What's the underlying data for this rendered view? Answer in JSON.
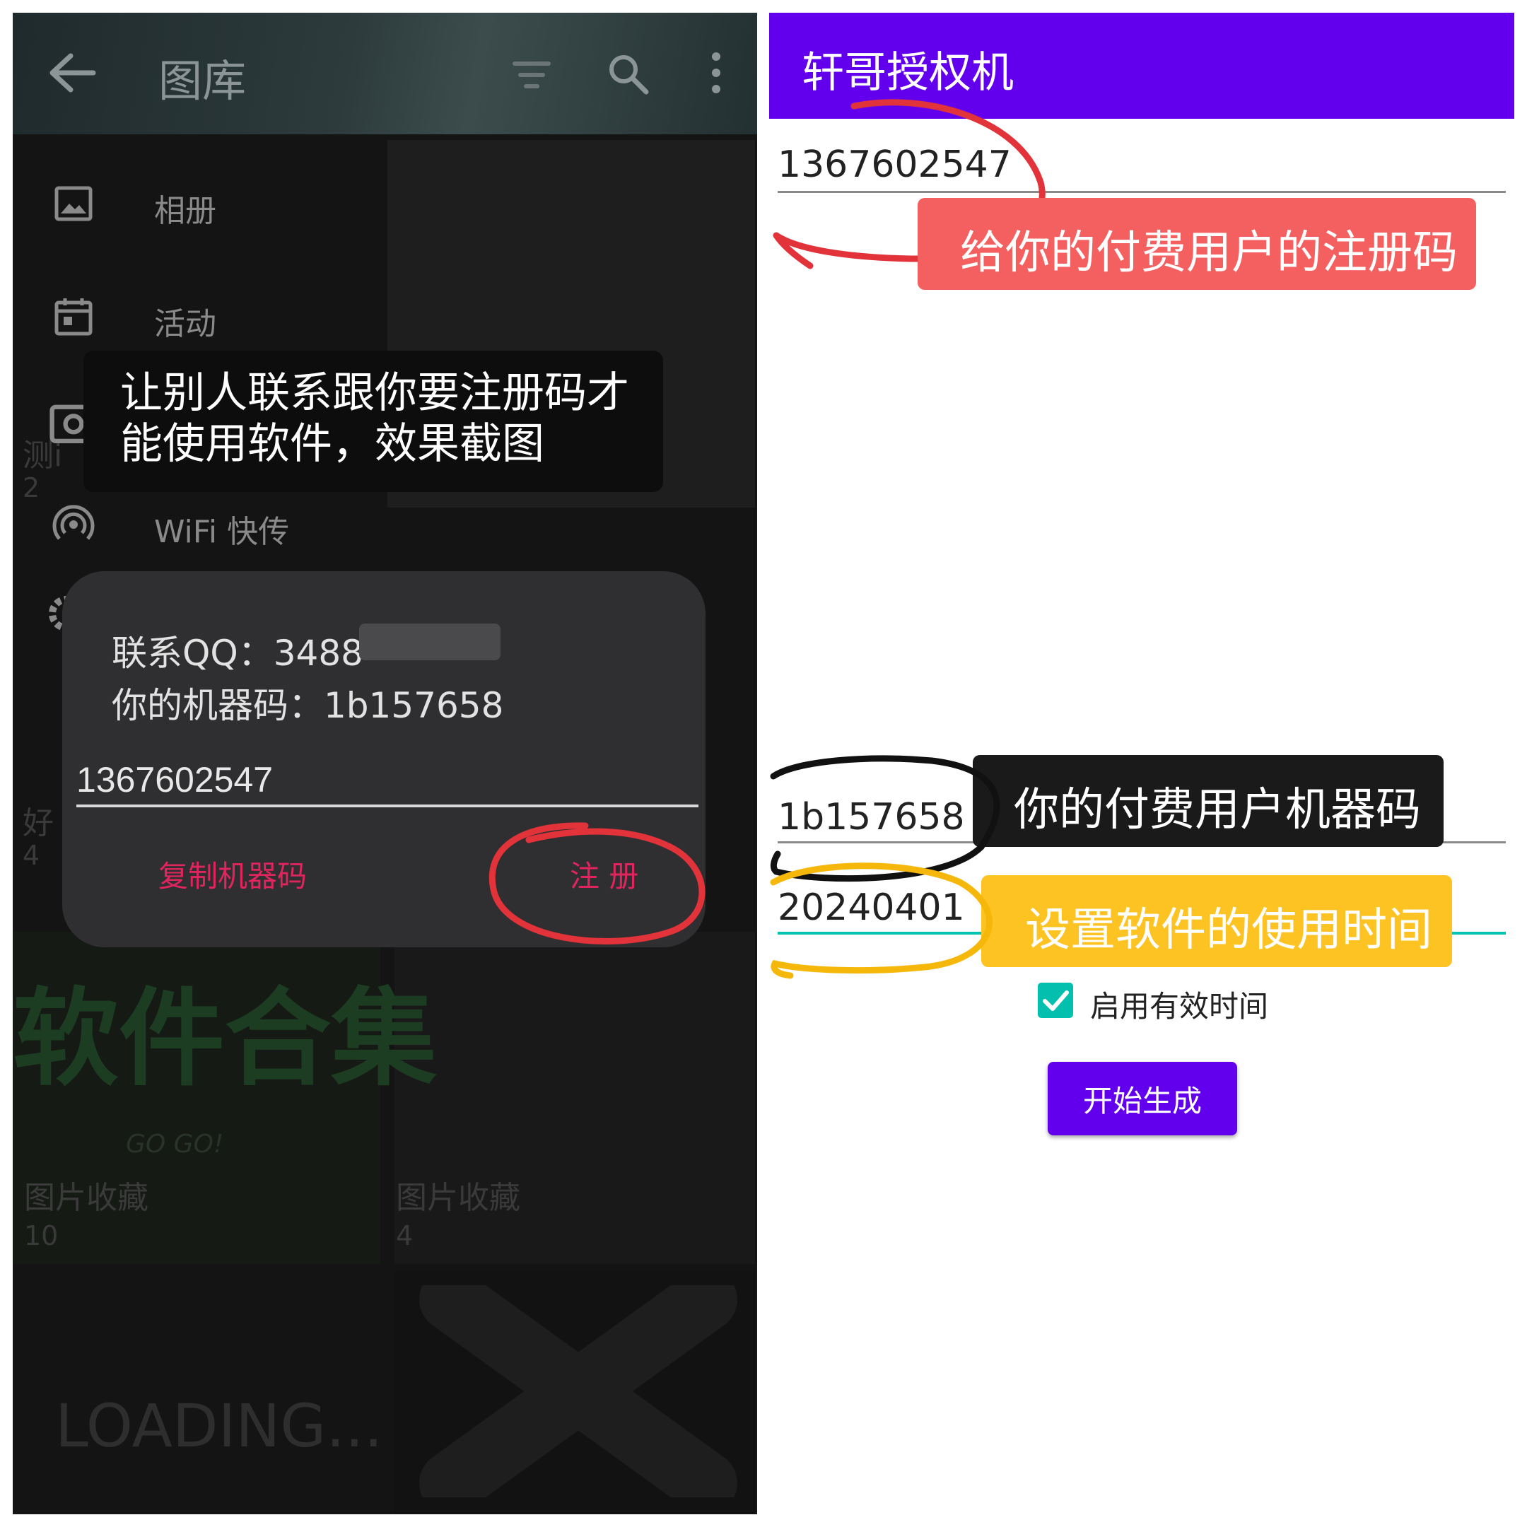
{
  "left": {
    "toolbar": {
      "title": "图库",
      "back_icon": "arrow-left-icon",
      "filter_icon": "filter-icon",
      "search_icon": "search-icon",
      "more_icon": "more-vert-icon"
    },
    "drawer": {
      "items": [
        {
          "label": "相册",
          "icon": "image-icon"
        },
        {
          "label": "活动",
          "icon": "calendar-icon"
        },
        {
          "label": "WiFi 快传",
          "icon": "wifi-broadcast-icon"
        }
      ]
    },
    "background_labels": {
      "side_a": "测i",
      "side_a_count": "2",
      "side_b": "好",
      "side_b_count": "4",
      "album1_title": "图片收藏",
      "album1_count": "10",
      "album2_title": "图片收藏",
      "album2_count": "4",
      "poster_text": "软件合集",
      "poster_sub": "GO GO!",
      "loading": "LOADING..."
    },
    "annotation": {
      "line1": "让别人联系跟你要注册码才",
      "line2": "能使用软件，效果截图"
    },
    "dialog": {
      "qq_line": "联系QQ：3488",
      "machine_line": "你的机器码：1b157658",
      "input_value": "1367602547",
      "copy_button": "复制机器码",
      "register_button": "注 册"
    }
  },
  "right": {
    "app_title": "轩哥授权机",
    "code_field": "1367602547",
    "code_callout": "给你的付费用户的注册码",
    "machine_field": "1b157658",
    "machine_callout": "你的付费用户机器码",
    "date_field": "20240401",
    "date_callout": "设置软件的使用时间",
    "checkbox_label": "启用有效时间",
    "checkbox_checked": true,
    "generate_button": "开始生成"
  },
  "colors": {
    "accent_purple": "#6200ee",
    "teal": "#03bfae",
    "dialog_button_red": "#e0245e",
    "callout_red": "#f46060",
    "callout_black": "#1a1a1a",
    "callout_yellow": "#fdc322"
  }
}
